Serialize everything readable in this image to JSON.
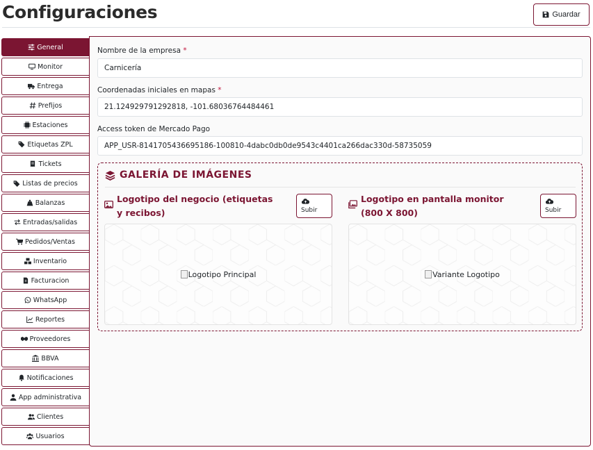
{
  "header": {
    "title": "Configuraciones",
    "save_label": "Guardar"
  },
  "sidebar": {
    "items": [
      {
        "label": "General",
        "icon": "sliders-icon",
        "active": true
      },
      {
        "label": "Monitor",
        "icon": "monitor-icon"
      },
      {
        "label": "Entrega",
        "icon": "truck-icon"
      },
      {
        "label": "Prefijos",
        "icon": "hash-icon"
      },
      {
        "label": "Estaciones",
        "icon": "chip-icon"
      },
      {
        "label": "Etiquetas ZPL",
        "icon": "tags-icon"
      },
      {
        "label": "Tickets",
        "icon": "receipt-icon"
      },
      {
        "label": "Listas de precios",
        "icon": "tags-icon"
      },
      {
        "label": "Balanzas",
        "icon": "scale-icon"
      },
      {
        "label": "Entradas/salidas",
        "icon": "exchange-icon"
      },
      {
        "label": "Pedidos/Ventas",
        "icon": "cart-icon"
      },
      {
        "label": "Inventario",
        "icon": "boxes-icon"
      },
      {
        "label": "Facturacion",
        "icon": "invoice-icon"
      },
      {
        "label": "WhatsApp",
        "icon": "whatsapp-icon"
      },
      {
        "label": "Reportes",
        "icon": "chart-line-icon"
      },
      {
        "label": "Proveedores",
        "icon": "handshake-icon"
      },
      {
        "label": "BBVA",
        "icon": "bank-icon"
      },
      {
        "label": "Notificaciones",
        "icon": "bell-icon"
      },
      {
        "label": "App administrativa",
        "icon": "user-icon"
      },
      {
        "label": "Clientes",
        "icon": "users-icon"
      },
      {
        "label": "Usuarios",
        "icon": "users-group-icon"
      }
    ]
  },
  "form": {
    "company_label": "Nombre de la empresa",
    "company_value": "Carnicería",
    "coords_label": "Coordenadas iniciales en mapas",
    "coords_value": "21.124929791292818, -101.68036764484461",
    "token_label": "Access token de Mercado Pago",
    "token_value": "APP_USR-8141705436695186-100810-4dabc0db0de9543c4401ca266dac330d-58735059",
    "required_mark": "*"
  },
  "gallery": {
    "title": "GALERÍA DE IMÁGENES",
    "logo_main": {
      "title": "Logotipo del negocio (etiquetas y recibos)",
      "upload_label": "Subir",
      "alt": "Logotipo Principal"
    },
    "logo_variant": {
      "title": "Logotipo en pantalla monitor (800 X 800)",
      "upload_label": "Subir",
      "alt": "Variante Logotipo"
    }
  },
  "colors": {
    "accent": "#7b1532",
    "required": "#c0143c"
  }
}
